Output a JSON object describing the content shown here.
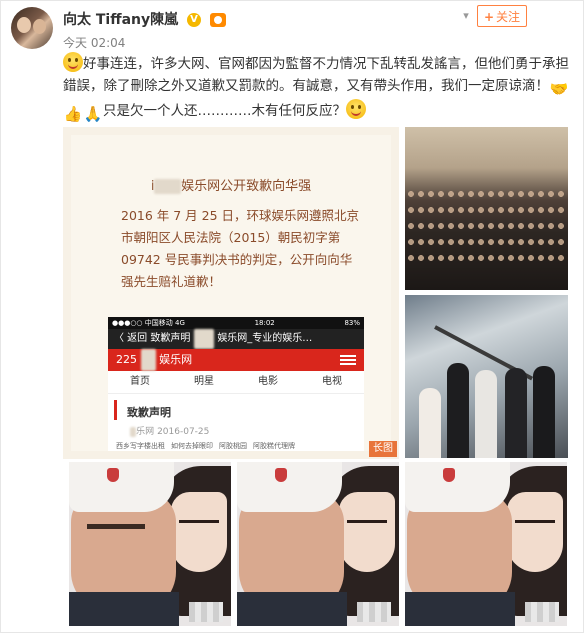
{
  "post": {
    "author": "向太 Tiffany陳嵐",
    "verified_icon": "verified-v-icon",
    "level_icon": "member-badge-icon",
    "follow_label": "关注",
    "follow_plus": "+",
    "time": "今天 02:04",
    "text_part1": "好事连连，许多大网、官网都因为監督不力情况下乱转乱发謠言，但他们勇于承担錯誤，除了刪除之外又道歉又罰款的。有誠意，又有帶头作用，我们一定原谅滴！",
    "text_part2": "只是欠一个人还…………木有任何反应？"
  },
  "document_image": {
    "title_prefix": "i",
    "title": "娱乐网公开致歉向华强",
    "body": "2016 年 7 月 25 日，环球娱乐网遵照北京市朝阳区人民法院（2015）朝民初字第 09742 号民事判决书的判定，公开向向华强先生赔礼道歉！",
    "phone": {
      "status_left": "●●●○○ 中国移动  4G",
      "status_time": "18:02",
      "status_right": "83%",
      "back_label": "〈 返回",
      "nav_title": "致歉声明",
      "nav_title2": "娱乐网_专业的娱乐…",
      "brand_prefix": "225",
      "brand": "娱乐网",
      "tabs": [
        "首页",
        "明星",
        "电影",
        "电视"
      ],
      "heading": "致歉声明",
      "sub_source": "乐网",
      "sub_date": "2016-07-25",
      "footer_links": [
        "西乡写字楼出租",
        "如何去掉眼印",
        "阿胶桃园",
        "阿胶糕代理牌"
      ]
    },
    "long_image_label": "长图"
  },
  "emoticons": [
    "smile-emoticon",
    "handshake-emoticon",
    "thumbs-up-emoticon",
    "bow-emoticon",
    "thinking-emoticon"
  ],
  "colors": {
    "follow_orange": "#ff8140",
    "doc_text": "#8a4b2a",
    "brand_red": "#d9261c",
    "long_image_badge": "#e8743a"
  }
}
